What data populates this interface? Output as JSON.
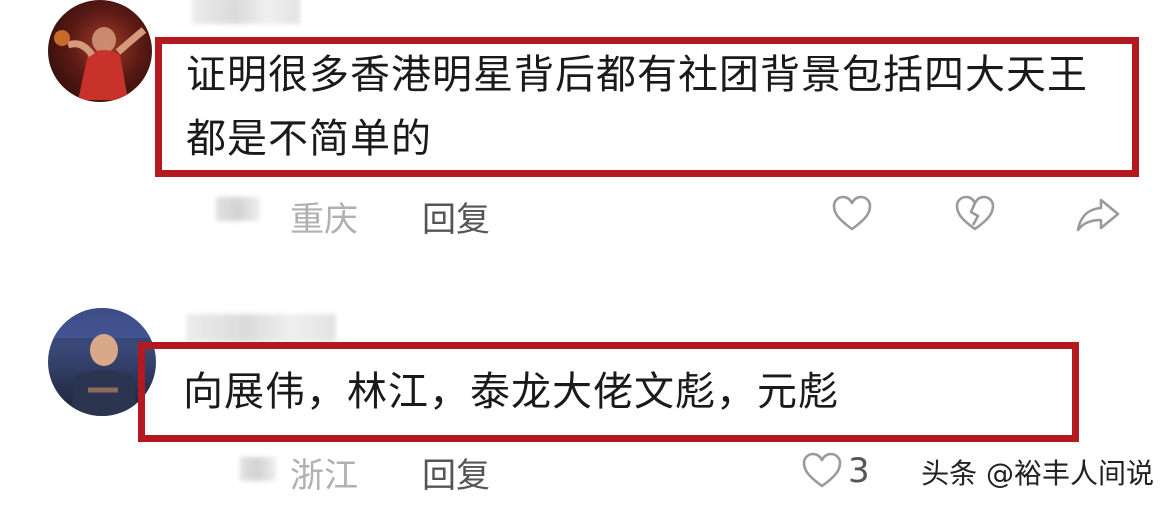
{
  "comments": [
    {
      "text": "证明很多香港明星背后都有社团背景包括四大天王都是不简单的",
      "location": "重庆",
      "reply_label": "回复",
      "like_count": ""
    },
    {
      "text": "向展伟，林江，泰龙大佬文彪，元彪",
      "location": "浙江",
      "reply_label": "回复",
      "like_count": "3"
    }
  ],
  "watermark": "头条 @裕丰人间说",
  "icons": {
    "like": "heart-outline-icon",
    "dislike": "broken-heart-icon",
    "share": "share-arrow-icon"
  },
  "colors": {
    "highlight_box": "#b5181e",
    "location_text": "#b0b0b0",
    "reply_text": "#555555"
  }
}
